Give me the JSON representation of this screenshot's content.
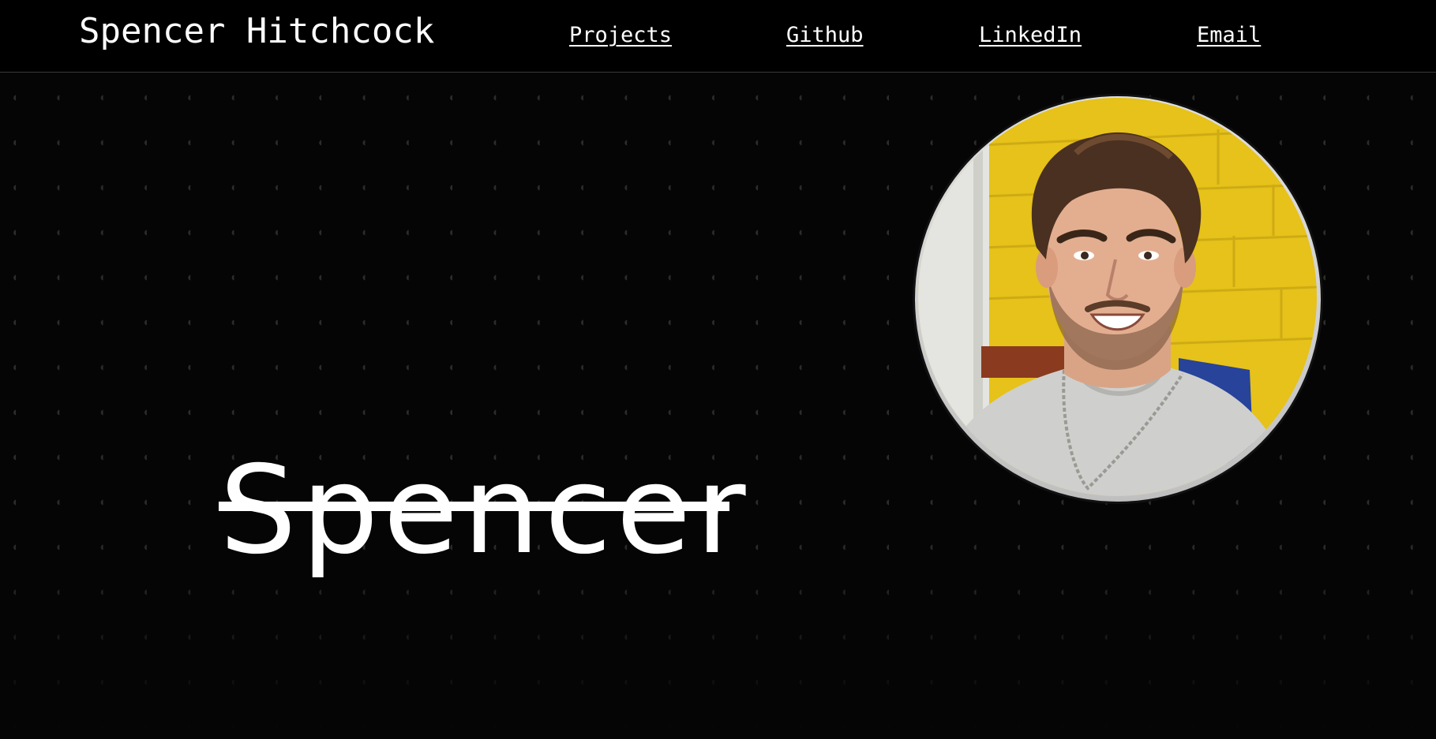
{
  "header": {
    "title": "Spencer Hitchcock",
    "nav": [
      {
        "label": "Projects"
      },
      {
        "label": "Github"
      },
      {
        "label": "LinkedIn"
      },
      {
        "label": "Email"
      }
    ]
  },
  "hero": {
    "name": "Spencer"
  },
  "colors": {
    "background": "#050505",
    "text": "#ffffff",
    "dot": "#2c2c2c",
    "wall": "#e8c41c"
  },
  "icons": {
    "portrait": "profile-photo"
  }
}
